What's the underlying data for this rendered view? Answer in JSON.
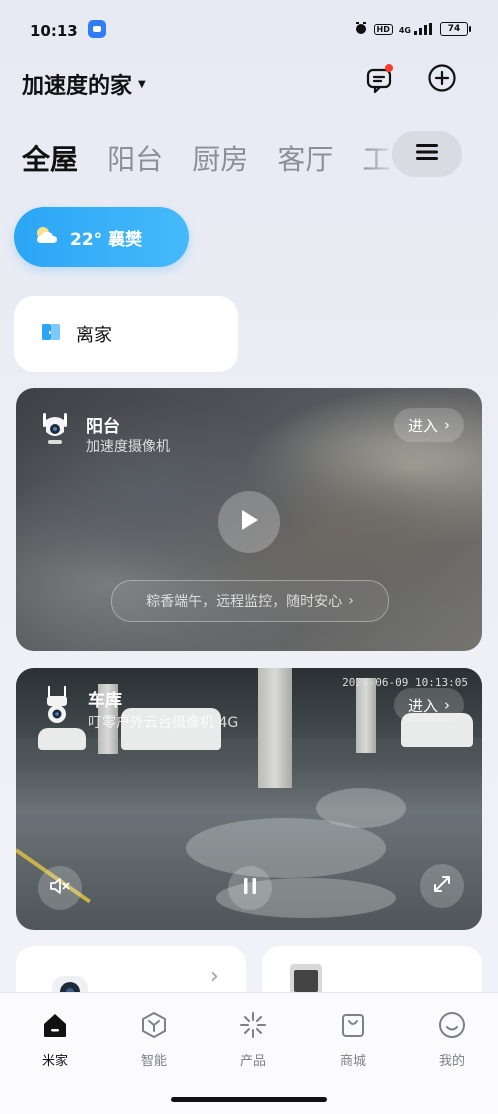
{
  "status_bar": {
    "time": "10:13",
    "network": "4G",
    "hd": "HD",
    "battery": "74"
  },
  "header": {
    "home_name": "加速度的家",
    "icons": [
      "message-icon",
      "add-icon"
    ]
  },
  "rooms": {
    "tabs": [
      "全屋",
      "阳台",
      "厨房",
      "客厅",
      "工"
    ],
    "active": "全屋"
  },
  "weather": {
    "text": "22° 襄樊"
  },
  "scene": {
    "label": "离家"
  },
  "cameras": [
    {
      "title": "阳台",
      "subtitle": "加速度摄像机",
      "enter_label": "进入",
      "promo": "粽香端午，远程监控，随时安心"
    },
    {
      "title": "车库",
      "subtitle": "叮零户外云台摄像机 4G",
      "enter_label": "进入",
      "timestamp": "2024-06-09 10:13:05"
    }
  ],
  "bottom_nav": {
    "items": [
      {
        "label": "米家",
        "icon": "home-icon",
        "active": true
      },
      {
        "label": "智能",
        "icon": "smart-icon",
        "active": false
      },
      {
        "label": "产品",
        "icon": "product-icon",
        "active": false
      },
      {
        "label": "商城",
        "icon": "shop-icon",
        "active": false
      },
      {
        "label": "我的",
        "icon": "profile-icon",
        "active": false
      }
    ]
  },
  "colors": {
    "accent_blue": "#2ba6f5",
    "badge_red": "#ff3b30"
  }
}
